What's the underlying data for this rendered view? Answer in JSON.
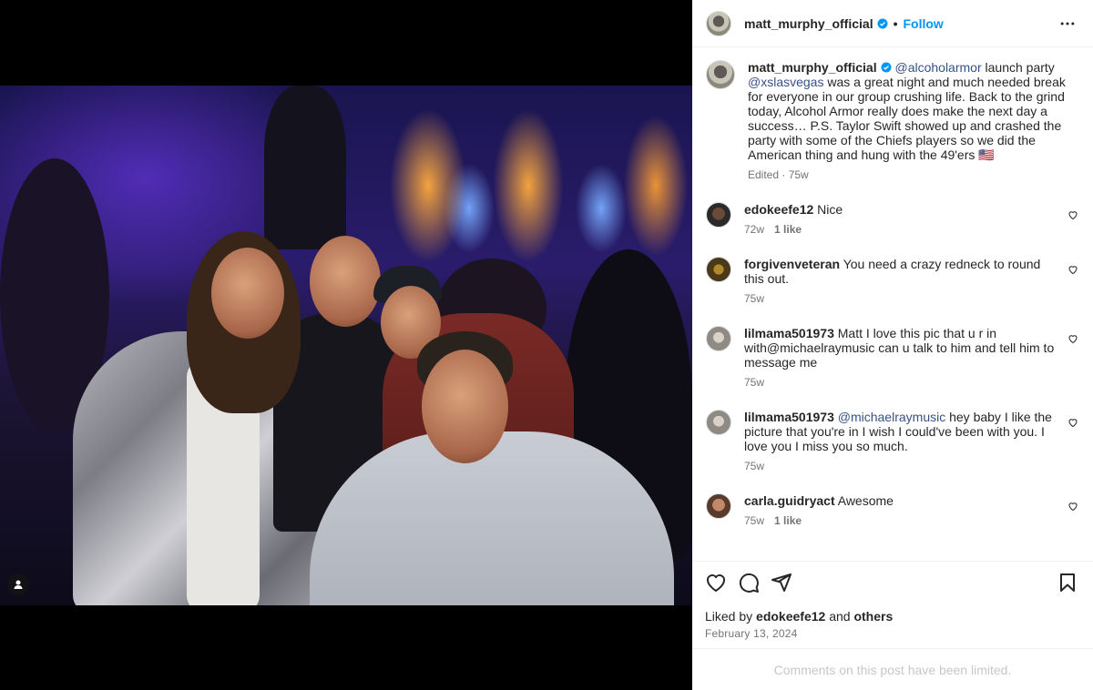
{
  "post": {
    "author": "matt_murphy_official",
    "follow_label": "Follow",
    "caption_mentions": [
      "@alcoholarmor",
      "@xslasvegas"
    ],
    "caption_part1": " launch party ",
    "caption_part2": " was a great night and much needed break for everyone in our group crushing life. Back to the grind today, Alcohol Armor really does make the next day a success… P.S. Taylor Swift showed up and crashed the party with some of the Chiefs players so we did the American thing and hung with the 49'ers 🇺🇸",
    "caption_meta": "Edited · 75w"
  },
  "comments": [
    {
      "user": "edokeefe12",
      "text": "Nice",
      "age": "72w",
      "likes": "1 like"
    },
    {
      "user": "forgivenveteran",
      "text": "You need a crazy redneck to round this out.",
      "age": "75w",
      "likes": ""
    },
    {
      "user": "lilmama501973",
      "text": "Matt I love this pic that u r in with@michaelraymusic can u talk to him and tell him to message me",
      "age": "75w",
      "likes": ""
    },
    {
      "user": "lilmama501973",
      "mention": "@michaelraymusic",
      "text": " hey baby I like the picture that you're in I wish I could've been with you. I love you I miss you so much.",
      "age": "75w",
      "likes": ""
    },
    {
      "user": "carla.guidryact",
      "text": "Awesome",
      "age": "75w",
      "likes": "1 like"
    }
  ],
  "footer": {
    "liked_by_prefix": "Liked by ",
    "liked_by_user": "edokeefe12",
    "liked_by_and": " and ",
    "liked_by_others": "others",
    "date": "February 13, 2024",
    "limited_notice": "Comments on this post have been limited."
  },
  "colors": {
    "link": "#0095f6",
    "mention": "#385185",
    "muted": "#737373"
  }
}
